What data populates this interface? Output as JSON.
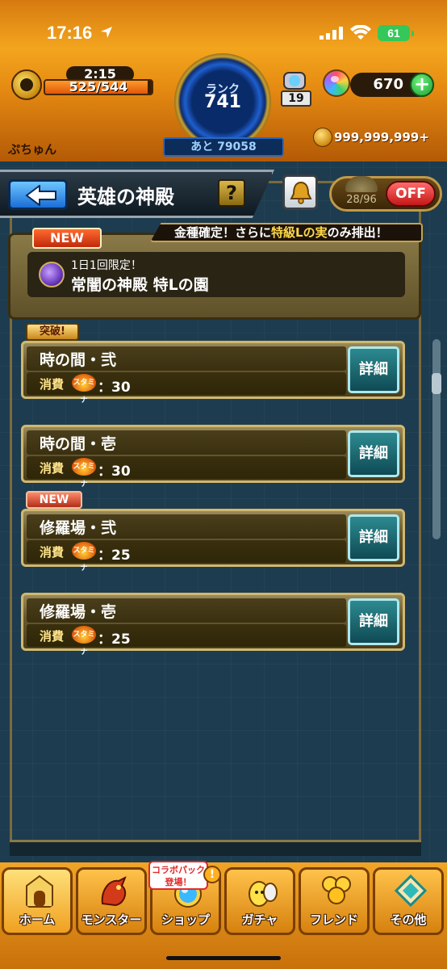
{
  "status_bar": {
    "time": "17:16",
    "battery": "61"
  },
  "header": {
    "stamina_timer": "2:15",
    "stamina": "525/544",
    "stamina_fraction": 0.965,
    "rank_label": "ランク",
    "rank_value": "741",
    "next_exp": "あと 79058",
    "capsule_count": "19",
    "orb_count": "670",
    "player_name": "ぷちゅん",
    "coin_count": "999,999,999+"
  },
  "title_bar": {
    "title": "英雄の神殿",
    "help": "?",
    "toggle_count": "28/96",
    "toggle_state": "OFF"
  },
  "event": {
    "badge": "NEW",
    "banner_prefix": "金種確定！さらに",
    "banner_highlight": "特級Lの実",
    "banner_suffix": "のみ排出！",
    "subtitle": "1日1回限定！",
    "title": "常闇の神殿 特Lの園"
  },
  "quests": [
    {
      "tag": "突破!",
      "name": "時の間・弐",
      "cost_label": "消費",
      "stamina_icon": "スタミナ",
      "cost": "：30",
      "detail": "詳細"
    },
    {
      "tag": "",
      "name": "時の間・壱",
      "cost_label": "消費",
      "stamina_icon": "スタミナ",
      "cost": "：30",
      "detail": "詳細"
    },
    {
      "tag": "NEW",
      "name": "修羅場・弐",
      "cost_label": "消費",
      "stamina_icon": "スタミナ",
      "cost": "：25",
      "detail": "詳細"
    },
    {
      "tag": "",
      "name": "修羅場・壱",
      "cost_label": "消費",
      "stamina_icon": "スタミナ",
      "cost": "：25",
      "detail": "詳細"
    }
  ],
  "bottom_nav": {
    "collab_bubble": "コラボパック登場！",
    "alert": "!",
    "items": [
      {
        "label": "ホーム",
        "icon": "home-gate-icon"
      },
      {
        "label": "モンスター",
        "icon": "dragon-icon"
      },
      {
        "label": "ショップ",
        "icon": "rainbow-orb-icon"
      },
      {
        "label": "ガチャ",
        "icon": "egg-icon"
      },
      {
        "label": "フレンド",
        "icon": "balloons-icon"
      },
      {
        "label": "その他",
        "icon": "diamond-menu-icon"
      }
    ]
  }
}
